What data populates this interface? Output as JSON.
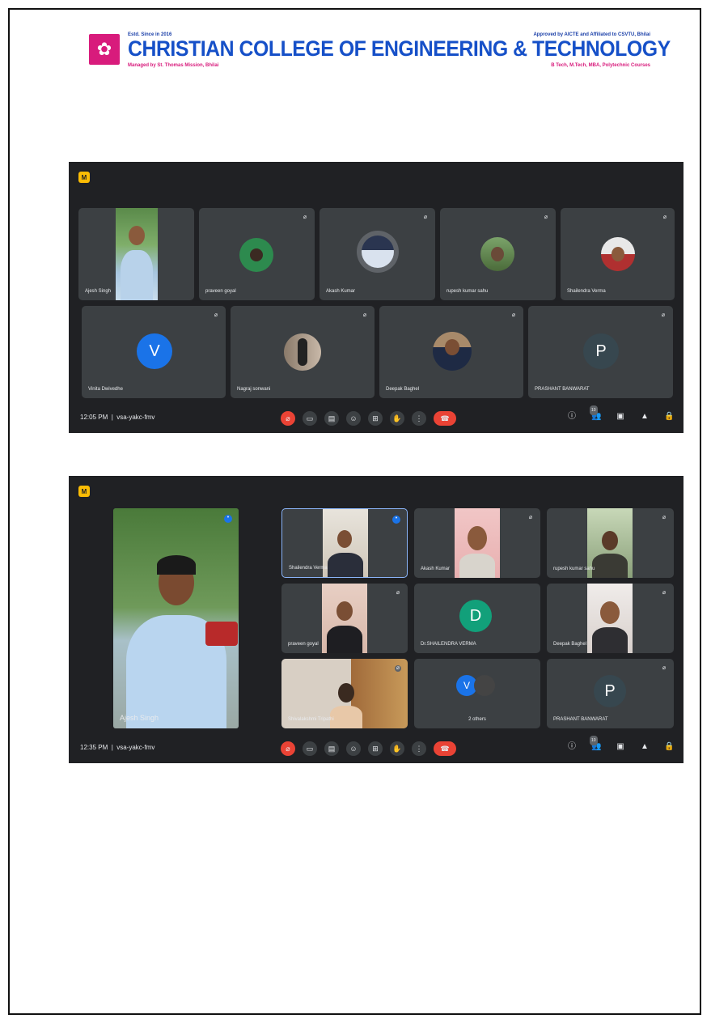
{
  "header": {
    "logo_icon": "flower-emblem-icon",
    "estd": "Estd. Since in 2016",
    "approved": "Approved by AICTE and Affiliated to CSVTU, Bhilai",
    "college_name": "CHRISTIAN COLLEGE OF ENGINEERING & TECHNOLOGY",
    "managed_by": "Managed by St. Thomas Mission, Bhilai",
    "motto": "B Tech, M.Tech, MBA, Polytechnic Courses"
  },
  "meeting1": {
    "time": "12:05 PM",
    "meeting_code": "vsa-yakc-fmv",
    "participant_count": "10",
    "participants": [
      {
        "name": "Ajesh Singh",
        "type": "video"
      },
      {
        "name": "praveen goyal",
        "type": "photo"
      },
      {
        "name": "Akash Kumar",
        "type": "photo"
      },
      {
        "name": "rupesh kumar sahu",
        "type": "photo"
      },
      {
        "name": "Shailendra Verma",
        "type": "photo"
      },
      {
        "name": "Vinita Dwivedhe",
        "type": "letter",
        "letter": "V",
        "color": "#1a73e8"
      },
      {
        "name": "Nagraj sonwani",
        "type": "photo"
      },
      {
        "name": "Deepak Baghel",
        "type": "photo"
      },
      {
        "name": "PRASHANT BANWARAT",
        "type": "letter",
        "letter": "P",
        "color": "#37474f"
      }
    ]
  },
  "meeting2": {
    "time": "12:35 PM",
    "meeting_code": "vsa-yakc-fmv",
    "participant_count": "10",
    "featured": {
      "name": "Ajesh Singh"
    },
    "participants": [
      {
        "name": "Shailendra Verma",
        "type": "video"
      },
      {
        "name": "Akash Kumar",
        "type": "video"
      },
      {
        "name": "rupesh kumar sahu",
        "type": "video"
      },
      {
        "name": "praveen goyal",
        "type": "video"
      },
      {
        "name": "Dr.SHAILENDRA VERMA",
        "type": "letter",
        "letter": "D",
        "color": "#12a07a"
      },
      {
        "name": "Deepak Baghel",
        "type": "video"
      },
      {
        "name": "Shivalakshmi Tripathi",
        "type": "video"
      },
      {
        "name": "2 others",
        "type": "group",
        "letter": "V",
        "color": "#1a73e8"
      },
      {
        "name": "PRASHANT BANWARAT",
        "type": "letter",
        "letter": "P",
        "color": "#37474f"
      }
    ]
  },
  "controls": {
    "mic": "mic-off-icon",
    "camera": "camera-icon",
    "captions": "captions-icon",
    "emoji": "emoji-icon",
    "present": "present-icon",
    "hand": "raise-hand-icon",
    "more": "more-vert-icon",
    "end": "end-call-icon"
  }
}
